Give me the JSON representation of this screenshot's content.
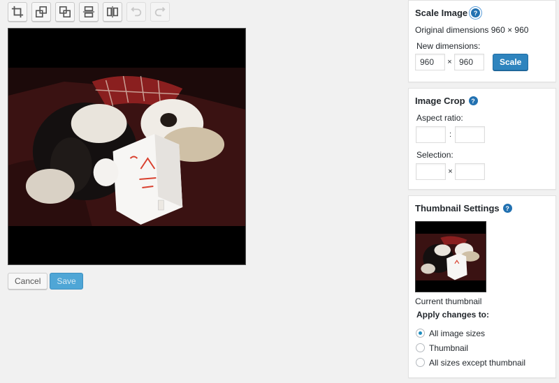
{
  "toolbar": {
    "buttons": [
      {
        "icon": "crop-icon",
        "enabled": true
      },
      {
        "icon": "rotate-left-icon",
        "enabled": true
      },
      {
        "icon": "rotate-right-icon",
        "enabled": true
      },
      {
        "icon": "flip-vertical-icon",
        "enabled": true
      },
      {
        "icon": "flip-horizontal-icon",
        "enabled": true
      },
      {
        "icon": "undo-icon",
        "enabled": false
      },
      {
        "icon": "redo-icon",
        "enabled": false
      }
    ]
  },
  "actions": {
    "cancel_label": "Cancel",
    "save_label": "Save"
  },
  "scale": {
    "title": "Scale Image",
    "original_text": "Original dimensions 960 × 960",
    "new_dimensions_label": "New dimensions:",
    "width": "960",
    "height": "960",
    "times": "×",
    "button_label": "Scale"
  },
  "crop": {
    "title": "Image Crop",
    "aspect_label": "Aspect ratio:",
    "aspect_sep": ":",
    "selection_label": "Selection:",
    "selection_sep": "×",
    "aspect_w": "",
    "aspect_h": "",
    "sel_w": "",
    "sel_h": ""
  },
  "thumbnail": {
    "title": "Thumbnail Settings",
    "caption": "Current thumbnail",
    "apply_label": "Apply changes to:",
    "options": [
      {
        "label": "All image sizes",
        "checked": true
      },
      {
        "label": "Thumbnail",
        "checked": false
      },
      {
        "label": "All sizes except thumbnail",
        "checked": false
      }
    ]
  },
  "colors": {
    "primary": "#2e84be",
    "help": "#2271b1",
    "background": "#f1f1f1"
  }
}
